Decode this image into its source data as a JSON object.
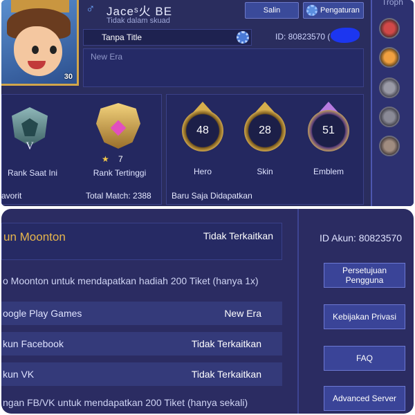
{
  "profile": {
    "name": "Jaceˢ火 BE",
    "gender_symbol": "♂",
    "squad_status": "Tidak dalam skuad",
    "level": "30",
    "salin_label": "Salin",
    "settings_label": "Pengaturan",
    "title_text": "Tanpa Title",
    "id_text": "ID: 80823570 (",
    "motto": "New Era"
  },
  "ranks": [
    {
      "label": "Rank Saat Ini",
      "tier": "V"
    },
    {
      "label": "Rank Tertinggi",
      "stars": "7",
      "star_symbol": "★"
    }
  ],
  "stats": [
    {
      "label": "Hero",
      "value": "48"
    },
    {
      "label": "Skin",
      "value": "28"
    },
    {
      "label": "Emblem",
      "value": "51"
    }
  ],
  "footer": {
    "favorit": "avorit",
    "total_match": "Total Match: 2388",
    "baru": "Baru Saja Didapatkan"
  },
  "trophy_title": "Troph",
  "account": {
    "title": "un Moonton",
    "title_value": "Tidak Terkaitkan",
    "id_akun": "ID Akun:  80823570",
    "rows": [
      {
        "text": "o Moonton untuk mendapatkan hadiah 200 Tiket (hanya 1x)",
        "value": ""
      },
      {
        "text": "oogle Play Games",
        "value": "New Era"
      },
      {
        "text": "kun Facebook",
        "value": "Tidak Terkaitkan"
      },
      {
        "text": "kun VK",
        "value": "Tidak Terkaitkan"
      },
      {
        "text": "ngan FB/VK untuk mendapatkan 200 Tiket (hanya sekali)",
        "value": ""
      }
    ],
    "buttons": [
      "Persetujuan Pengguna",
      "Kebijakan Privasi",
      "FAQ",
      "Advanced Server"
    ]
  },
  "colors": {
    "panel_bg": "#2a2d5e",
    "accent_gold": "#e7b64c",
    "button_blue": "#3a4498",
    "redacted_blob": "#1c36f0"
  }
}
